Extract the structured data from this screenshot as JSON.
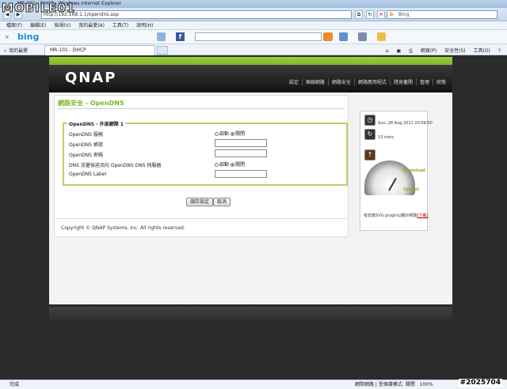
{
  "watermark": "MOBILE01",
  "window": {
    "title": "MR-101 - DHCP - Windows Internet Explorer"
  },
  "address": {
    "url": "http://192.168.1.1/opendns.asp",
    "search_placeholder": "Bing"
  },
  "menubar": [
    "檔案(F)",
    "編輯(E)",
    "檢視(V)",
    "我的最愛(A)",
    "工具(T)",
    "說明(H)"
  ],
  "bingbar": {
    "logo": "bing",
    "fb": "f"
  },
  "favbar": {
    "favorites": "我的最愛",
    "tab": "MR-101 - DHCP",
    "cmds": [
      "網頁(P)",
      "安全性(S)",
      "工具(O)"
    ]
  },
  "router": {
    "logo": "QNAP",
    "nav": [
      "設定",
      "無線網路",
      "網路安全",
      "網路應用程式",
      "隱身蓄開",
      "管理",
      "狀態"
    ],
    "page_title": "網路安全 - OpenDNS",
    "legend": "OpenDNS - 外部網際 1",
    "rows": [
      {
        "label": "OpenDNS 服務"
      },
      {
        "label": "OpenDNS 帳號"
      },
      {
        "label": "OpenDNS 密碼"
      },
      {
        "label": "DNS 流量強迫流向 OpenDNS DNS 伺服器"
      },
      {
        "label": "OpenDNS Label"
      }
    ],
    "radio_on": "啟動",
    "radio_off": "關閉",
    "save_button": "儲存設定",
    "cancel_button": "取消",
    "copyright": "Copyright © QNAP Systems, Inc. All rights reserved."
  },
  "sidebar": {
    "datetime": "Sun, 28 Aug 2011 20:09:50",
    "uptime": "13 mins",
    "download": "Download",
    "upload": "Upload",
    "note": "有安裝SVG plugin以顯示頻寬",
    "note_link": "[下載]"
  },
  "statusbar": {
    "left": "完成",
    "zone": "網際網路 | 受保護模式: 關閉",
    "zoom": "100%",
    "id": "#2025704"
  }
}
